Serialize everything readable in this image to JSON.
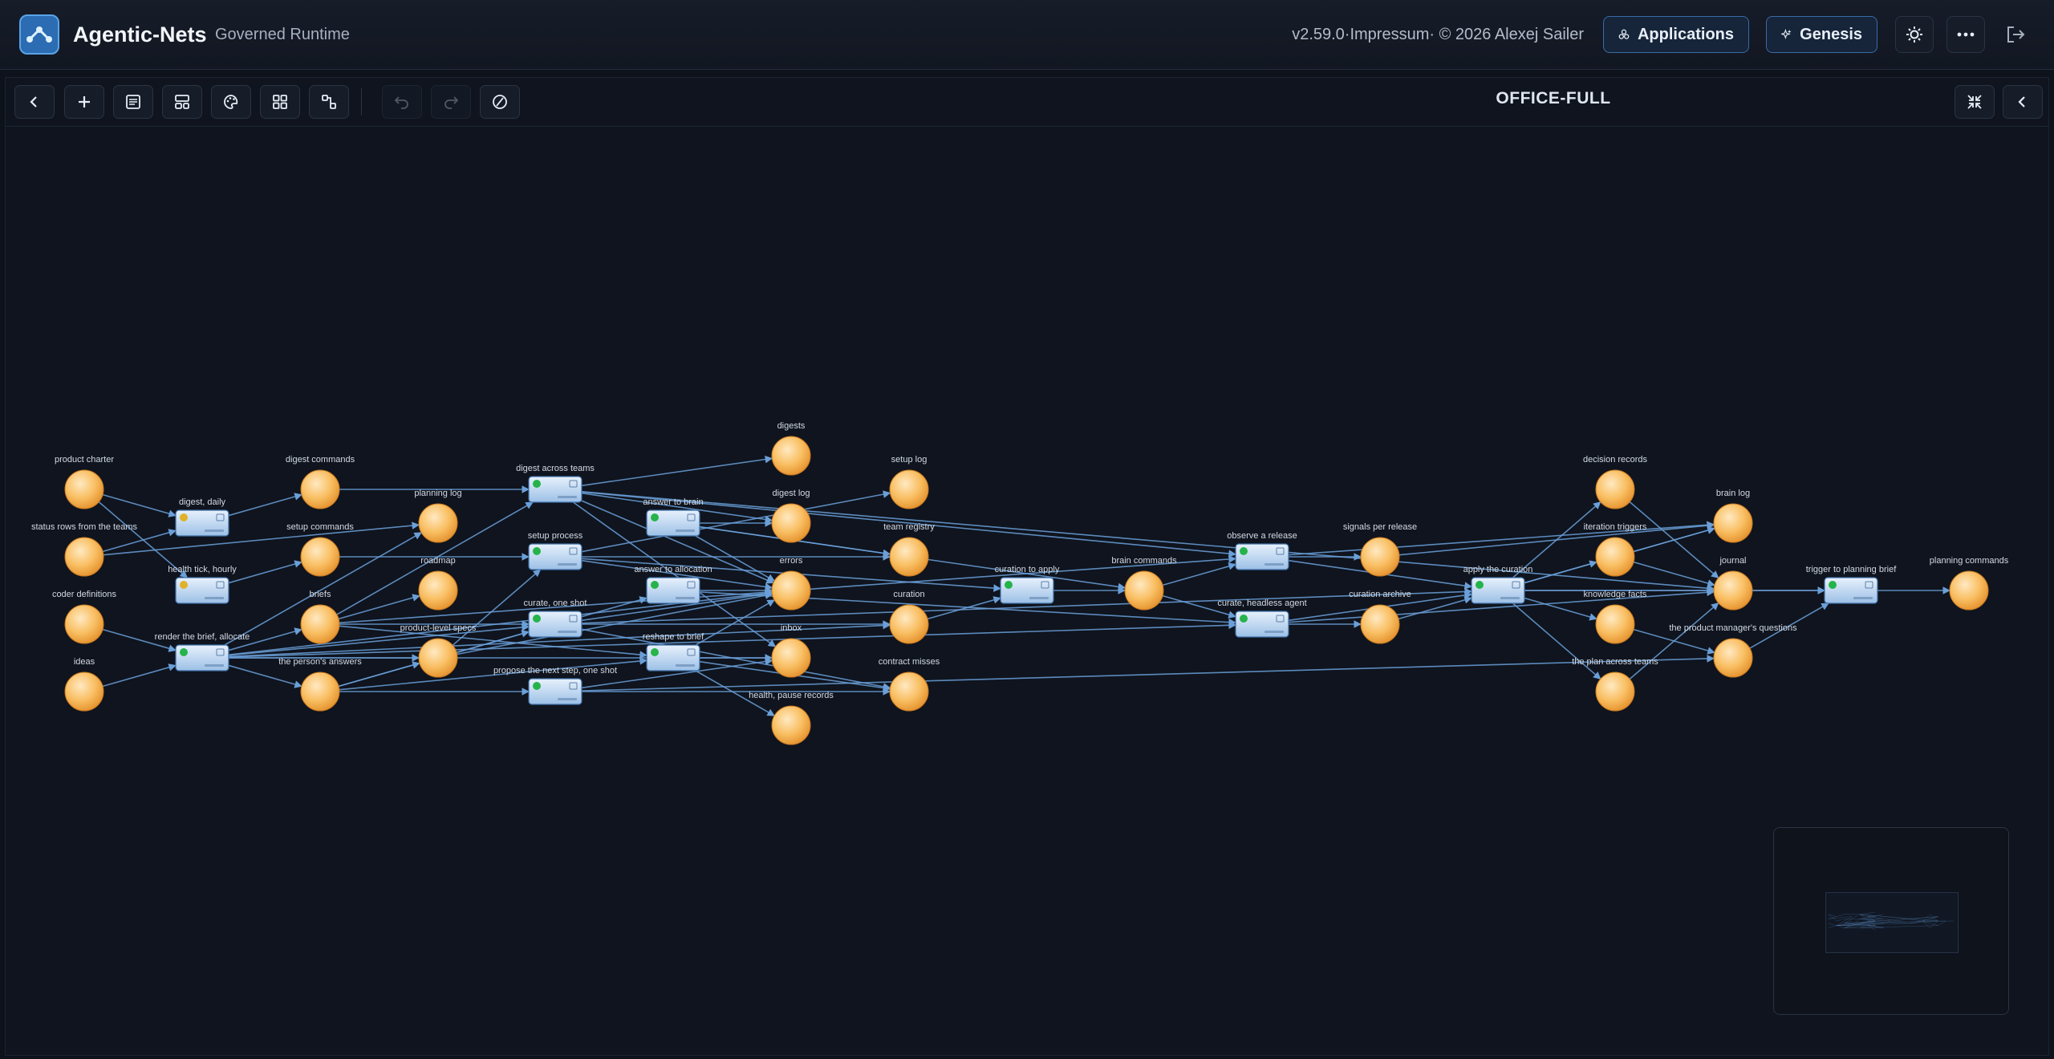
{
  "header": {
    "app_title": "Agentic-Nets",
    "app_subtitle": "Governed Runtime",
    "version": "v2.59.0·Impressum· © 2026 Alexej Sailer",
    "applications_label": "Applications",
    "genesis_label": "Genesis",
    "icons": [
      "logo-icon",
      "applications-icon",
      "genesis-icon",
      "sun-icon",
      "ellipsis-icon",
      "logout-icon"
    ]
  },
  "toolbar": {
    "net_title": "OFFICE-FULL",
    "buttons": [
      "back",
      "add",
      "list",
      "layout",
      "palette",
      "grid",
      "connect",
      "undo",
      "redo",
      "disable",
      "collapse",
      "panel-toggle"
    ]
  },
  "colors": {
    "background": "#0d121b",
    "edge": "#6a9fd8",
    "place_fill": "#f6b14f",
    "transition_fill": "#c9ddf3",
    "status_green": "#26b34a",
    "status_yellow": "#e0b22a",
    "accent": "#3a6aa6"
  },
  "graph": {
    "places": [
      {
        "id": "p1",
        "label": "product charter"
      },
      {
        "id": "p2",
        "label": "status rows from the teams"
      },
      {
        "id": "p3",
        "label": "coder definitions"
      },
      {
        "id": "p4",
        "label": "ideas"
      },
      {
        "id": "p5",
        "label": "digest commands"
      },
      {
        "id": "p6",
        "label": "setup commands"
      },
      {
        "id": "p7",
        "label": "briefs"
      },
      {
        "id": "p8",
        "label": "the person's answers"
      },
      {
        "id": "p9",
        "label": "planning log"
      },
      {
        "id": "p10",
        "label": "roadmap"
      },
      {
        "id": "p11",
        "label": "product-level specs"
      },
      {
        "id": "p12",
        "label": "digests"
      },
      {
        "id": "p13",
        "label": "digest log"
      },
      {
        "id": "p14",
        "label": "errors"
      },
      {
        "id": "p15",
        "label": "inbox"
      },
      {
        "id": "p16",
        "label": "health, pause records"
      },
      {
        "id": "p17",
        "label": "setup log"
      },
      {
        "id": "p18",
        "label": "team registry"
      },
      {
        "id": "p19",
        "label": "curation"
      },
      {
        "id": "p20",
        "label": "contract misses"
      },
      {
        "id": "p21",
        "label": "brain commands"
      },
      {
        "id": "p22",
        "label": "signals per release"
      },
      {
        "id": "p23",
        "label": "curation archive"
      },
      {
        "id": "p24",
        "label": "decision records"
      },
      {
        "id": "p25",
        "label": "iteration triggers"
      },
      {
        "id": "p26",
        "label": "knowledge facts"
      },
      {
        "id": "p27",
        "label": "the plan across teams"
      },
      {
        "id": "p28",
        "label": "brain log"
      },
      {
        "id": "p29",
        "label": "journal"
      },
      {
        "id": "p30",
        "label": "the product manager's questions"
      },
      {
        "id": "p31",
        "label": "planning commands"
      }
    ],
    "transitions": [
      {
        "id": "t1",
        "label": "digest, daily",
        "status": "yellow"
      },
      {
        "id": "t2",
        "label": "health tick, hourly",
        "status": "yellow"
      },
      {
        "id": "t3",
        "label": "render the brief, allocate",
        "status": "green"
      },
      {
        "id": "t4",
        "label": "digest across teams",
        "status": "green"
      },
      {
        "id": "t5",
        "label": "setup process",
        "status": "green"
      },
      {
        "id": "t6",
        "label": "curate, one shot",
        "status": "green"
      },
      {
        "id": "t7",
        "label": "propose the next step, one shot",
        "status": "green"
      },
      {
        "id": "t8",
        "label": "answer to brain",
        "status": "green"
      },
      {
        "id": "t9",
        "label": "answer to allocation",
        "status": "green"
      },
      {
        "id": "t10",
        "label": "reshape to brief",
        "status": "green"
      },
      {
        "id": "t11",
        "label": "curation to apply",
        "status": "green"
      },
      {
        "id": "t12",
        "label": "observe a release",
        "status": "green"
      },
      {
        "id": "t13",
        "label": "curate, headless agent",
        "status": "green"
      },
      {
        "id": "t14",
        "label": "apply the curation",
        "status": "green"
      },
      {
        "id": "t15",
        "label": "trigger to planning brief",
        "status": "green"
      }
    ],
    "edges": [
      [
        "p1",
        "t1"
      ],
      [
        "p1",
        "t2"
      ],
      [
        "p2",
        "t1"
      ],
      [
        "t1",
        "p5"
      ],
      [
        "t2",
        "p6"
      ],
      [
        "p2",
        "p9"
      ],
      [
        "p3",
        "t3"
      ],
      [
        "p4",
        "t3"
      ],
      [
        "t3",
        "p7"
      ],
      [
        "t3",
        "p8"
      ],
      [
        "t3",
        "p9"
      ],
      [
        "t3",
        "p11"
      ],
      [
        "t3",
        "t6"
      ],
      [
        "t3",
        "t13"
      ],
      [
        "t3",
        "p19"
      ],
      [
        "t3",
        "p14"
      ],
      [
        "t3",
        "p15"
      ],
      [
        "p5",
        "t4"
      ],
      [
        "p6",
        "t5"
      ],
      [
        "p7",
        "t4"
      ],
      [
        "p7",
        "p10"
      ],
      [
        "p7",
        "t6"
      ],
      [
        "p7",
        "t10"
      ],
      [
        "p7",
        "t12"
      ],
      [
        "p8",
        "t7"
      ],
      [
        "p8",
        "t9"
      ],
      [
        "p8",
        "t10"
      ],
      [
        "p8",
        "p11"
      ],
      [
        "p11",
        "t6"
      ],
      [
        "p11",
        "t5"
      ],
      [
        "p11",
        "p14"
      ],
      [
        "t4",
        "p12"
      ],
      [
        "t4",
        "p13"
      ],
      [
        "t4",
        "p14"
      ],
      [
        "t4",
        "p15"
      ],
      [
        "t4",
        "t12"
      ],
      [
        "t4",
        "p29"
      ],
      [
        "t5",
        "p17"
      ],
      [
        "t5",
        "p18"
      ],
      [
        "t5",
        "p14"
      ],
      [
        "t5",
        "t11"
      ],
      [
        "t6",
        "p14"
      ],
      [
        "t6",
        "p19"
      ],
      [
        "t6",
        "p20"
      ],
      [
        "t6",
        "t14"
      ],
      [
        "t7",
        "p15"
      ],
      [
        "t7",
        "p20"
      ],
      [
        "t7",
        "p30"
      ],
      [
        "t8",
        "p13"
      ],
      [
        "t8",
        "p14"
      ],
      [
        "t8",
        "p18"
      ],
      [
        "t8",
        "p21"
      ],
      [
        "t9",
        "p14"
      ],
      [
        "t9",
        "t13"
      ],
      [
        "t10",
        "p14"
      ],
      [
        "t10",
        "p15"
      ],
      [
        "t10",
        "p16"
      ],
      [
        "t10",
        "p20"
      ],
      [
        "p19",
        "t11"
      ],
      [
        "t11",
        "p21"
      ],
      [
        "p21",
        "t12"
      ],
      [
        "p21",
        "t13"
      ],
      [
        "t12",
        "p22"
      ],
      [
        "t12",
        "t14"
      ],
      [
        "t12",
        "p28"
      ],
      [
        "t13",
        "p23"
      ],
      [
        "t13",
        "t14"
      ],
      [
        "t13",
        "p29"
      ],
      [
        "p22",
        "p28"
      ],
      [
        "p23",
        "t14"
      ],
      [
        "t14",
        "p24"
      ],
      [
        "t14",
        "p25"
      ],
      [
        "t14",
        "p26"
      ],
      [
        "t14",
        "p27"
      ],
      [
        "t14",
        "p28"
      ],
      [
        "t14",
        "p29"
      ],
      [
        "t14",
        "t15"
      ],
      [
        "p25",
        "p28"
      ],
      [
        "p25",
        "p29"
      ],
      [
        "p26",
        "p30"
      ],
      [
        "p29",
        "t15"
      ],
      [
        "t15",
        "p31"
      ],
      [
        "p30",
        "t15"
      ],
      [
        "p24",
        "p29"
      ],
      [
        "p27",
        "p29"
      ]
    ]
  }
}
